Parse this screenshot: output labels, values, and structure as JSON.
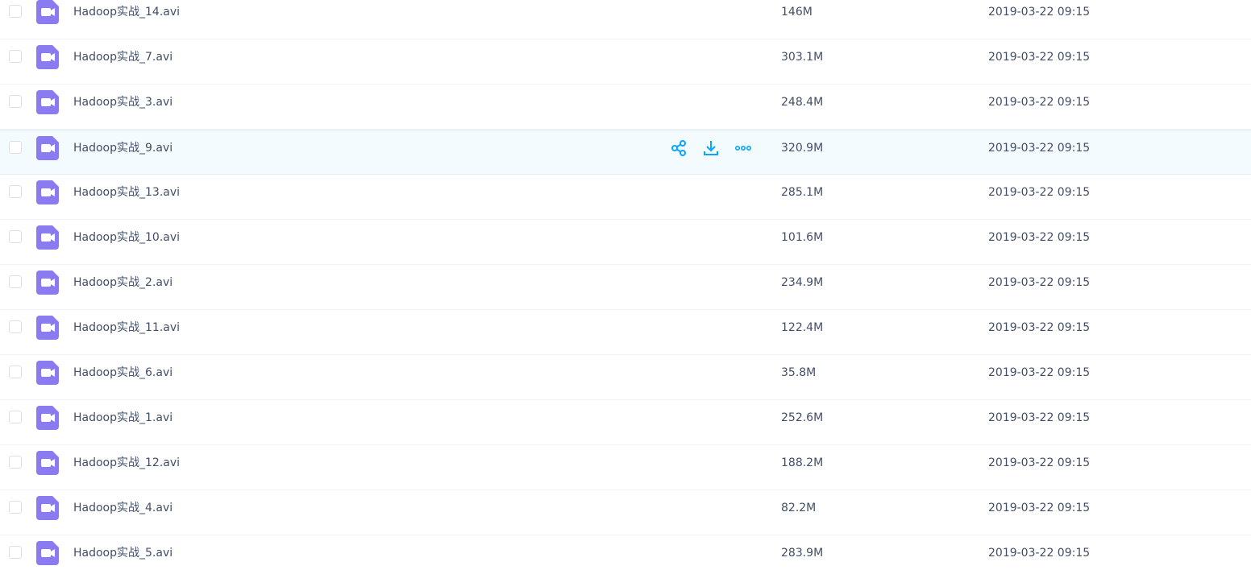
{
  "colors": {
    "icon_purple": "#8a7bf0",
    "action_blue": "#06a7ff",
    "text": "#424e67",
    "hover_bg": "#f4fbff"
  },
  "hover_row_index": 3,
  "actions": {
    "share_icon": "share-icon",
    "download_icon": "download-icon",
    "more_icon": "more-icon"
  },
  "files": [
    {
      "name": "Hadoop实战_14.avi",
      "size": "146M",
      "modified": "2019-03-22 09:15"
    },
    {
      "name": "Hadoop实战_7.avi",
      "size": "303.1M",
      "modified": "2019-03-22 09:15"
    },
    {
      "name": "Hadoop实战_3.avi",
      "size": "248.4M",
      "modified": "2019-03-22 09:15"
    },
    {
      "name": "Hadoop实战_9.avi",
      "size": "320.9M",
      "modified": "2019-03-22 09:15"
    },
    {
      "name": "Hadoop实战_13.avi",
      "size": "285.1M",
      "modified": "2019-03-22 09:15"
    },
    {
      "name": "Hadoop实战_10.avi",
      "size": "101.6M",
      "modified": "2019-03-22 09:15"
    },
    {
      "name": "Hadoop实战_2.avi",
      "size": "234.9M",
      "modified": "2019-03-22 09:15"
    },
    {
      "name": "Hadoop实战_11.avi",
      "size": "122.4M",
      "modified": "2019-03-22 09:15"
    },
    {
      "name": "Hadoop实战_6.avi",
      "size": "35.8M",
      "modified": "2019-03-22 09:15"
    },
    {
      "name": "Hadoop实战_1.avi",
      "size": "252.6M",
      "modified": "2019-03-22 09:15"
    },
    {
      "name": "Hadoop实战_12.avi",
      "size": "188.2M",
      "modified": "2019-03-22 09:15"
    },
    {
      "name": "Hadoop实战_4.avi",
      "size": "82.2M",
      "modified": "2019-03-22 09:15"
    },
    {
      "name": "Hadoop实战_5.avi",
      "size": "283.9M",
      "modified": "2019-03-22 09:15"
    }
  ]
}
